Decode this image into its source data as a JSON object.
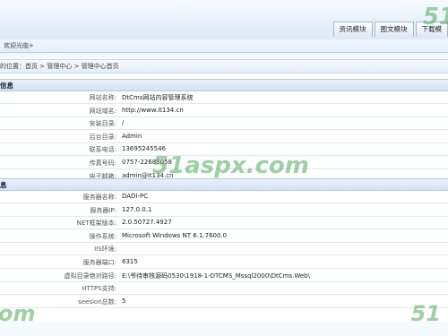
{
  "header": {
    "welcome": "欢迎光临+",
    "tabs": [
      "资讯模块",
      "图文模块",
      "下载模"
    ]
  },
  "breadcrumb": {
    "prefix": "的位置：",
    "items": [
      "首页",
      "管理中心",
      "管理中心首页"
    ],
    "separator": ">"
  },
  "site_info": {
    "title": "信息",
    "rows": [
      {
        "label": "网站名称:",
        "value": "DtCms网站内容管理系统"
      },
      {
        "label": "网站域名:",
        "value": "http://www.it134.cn"
      },
      {
        "label": "安装目录:",
        "value": "/"
      },
      {
        "label": "后台目录:",
        "value": "Admin"
      },
      {
        "label": "联系电话:",
        "value": "13695245546"
      },
      {
        "label": "传真号码:",
        "value": "0757-22687058"
      },
      {
        "label": "电子邮箱:",
        "value": "admin@it134.cn"
      }
    ]
  },
  "server_info": {
    "title": "息",
    "rows": [
      {
        "label": "服务器名称:",
        "value": "DADI-PC"
      },
      {
        "label": "服务器IP:",
        "value": "127.0.0.1"
      },
      {
        "label": "NET框架版本:",
        "value": "2.0.50727.4927"
      },
      {
        "label": "操作系统:",
        "value": "Microsoft Windows NT 6.1.7600.0"
      },
      {
        "label": "IIS环境:",
        "value": ""
      },
      {
        "label": "服务器端口:",
        "value": "6315"
      },
      {
        "label": "虚拟目录绝对路径:",
        "value": "E:\\爷待审核源码0530\\1918-1-DTCMS_Mssql2000\\DtCms.Web\\"
      },
      {
        "label": "HTTPS支持:",
        "value": ""
      },
      {
        "label": "seesion总数:",
        "value": "5"
      }
    ]
  },
  "watermarks": {
    "top_right": "51",
    "middle": "51aspx.com",
    "bottom_left": "om",
    "bottom_right": "51",
    "color": "#50aa5a"
  }
}
